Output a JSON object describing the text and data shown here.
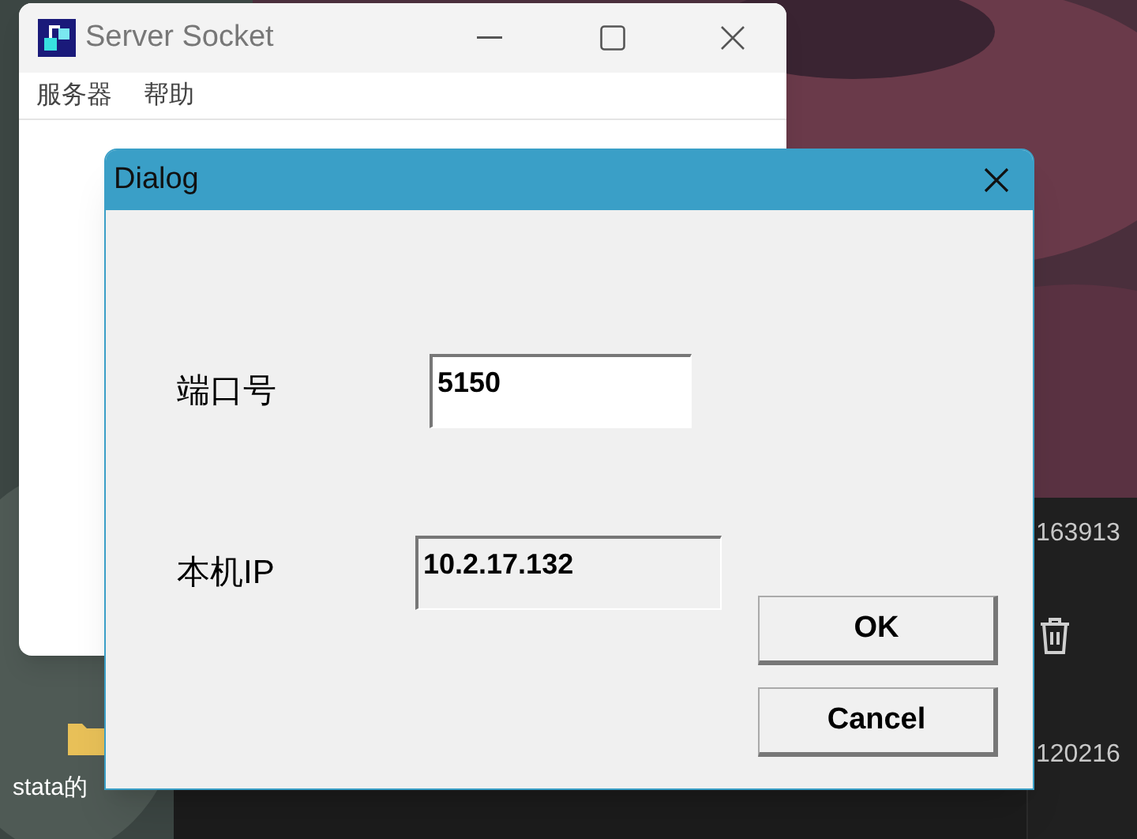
{
  "desktop_icon": {
    "lines": [
      "stata的"
    ]
  },
  "explorer": {
    "file_rows": [
      "163913",
      "120216"
    ]
  },
  "server_window": {
    "title": "Server Socket",
    "menu": [
      "服务器",
      "帮助"
    ]
  },
  "dialog": {
    "title": "Dialog",
    "fields": [
      {
        "label": "端口号",
        "value": "5150",
        "disabled": false
      },
      {
        "label": "本机IP",
        "value": "10.2.17.132",
        "disabled": true
      }
    ],
    "buttons": [
      "OK",
      "Cancel"
    ]
  }
}
